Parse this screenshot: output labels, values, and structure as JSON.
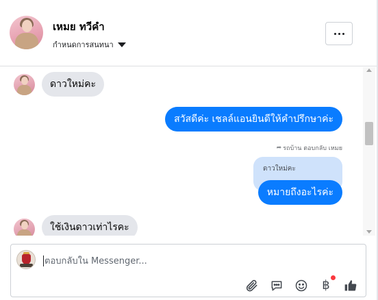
{
  "header": {
    "contact_name": "เหมย ทวีคำ",
    "subtitle": "กำหนดการสนทนา",
    "more_label": "..."
  },
  "messages": [
    {
      "side": "incoming",
      "text": "ดาวใหม่คะ"
    },
    {
      "side": "outgoing",
      "text": "สวัสดีค่ะ เชลล์แอนยินดีให้คำปรึกษาค่ะ"
    },
    {
      "side": "outgoing",
      "reply_meta": "รถบ้าน ตอบกลับ เหมย",
      "quoted": "ดาวใหม่คะ",
      "text": "หมายถึงอะไรค่ะ"
    },
    {
      "side": "incoming",
      "text": "ใช้เงินดาวเท่าไรคะ"
    }
  ],
  "composer": {
    "placeholder": "ตอบกลับใน Messenger...",
    "tools": [
      "attach-icon",
      "chat-bubble-icon",
      "emoji-icon",
      "baht-icon",
      "like-icon"
    ],
    "baht_symbol": "฿"
  },
  "colors": {
    "outgoing_bubble": "#0a7cff",
    "incoming_bubble": "#e4e6eb",
    "quoted_bubble": "#cfe2fb",
    "notification_dot": "#fa383e"
  }
}
